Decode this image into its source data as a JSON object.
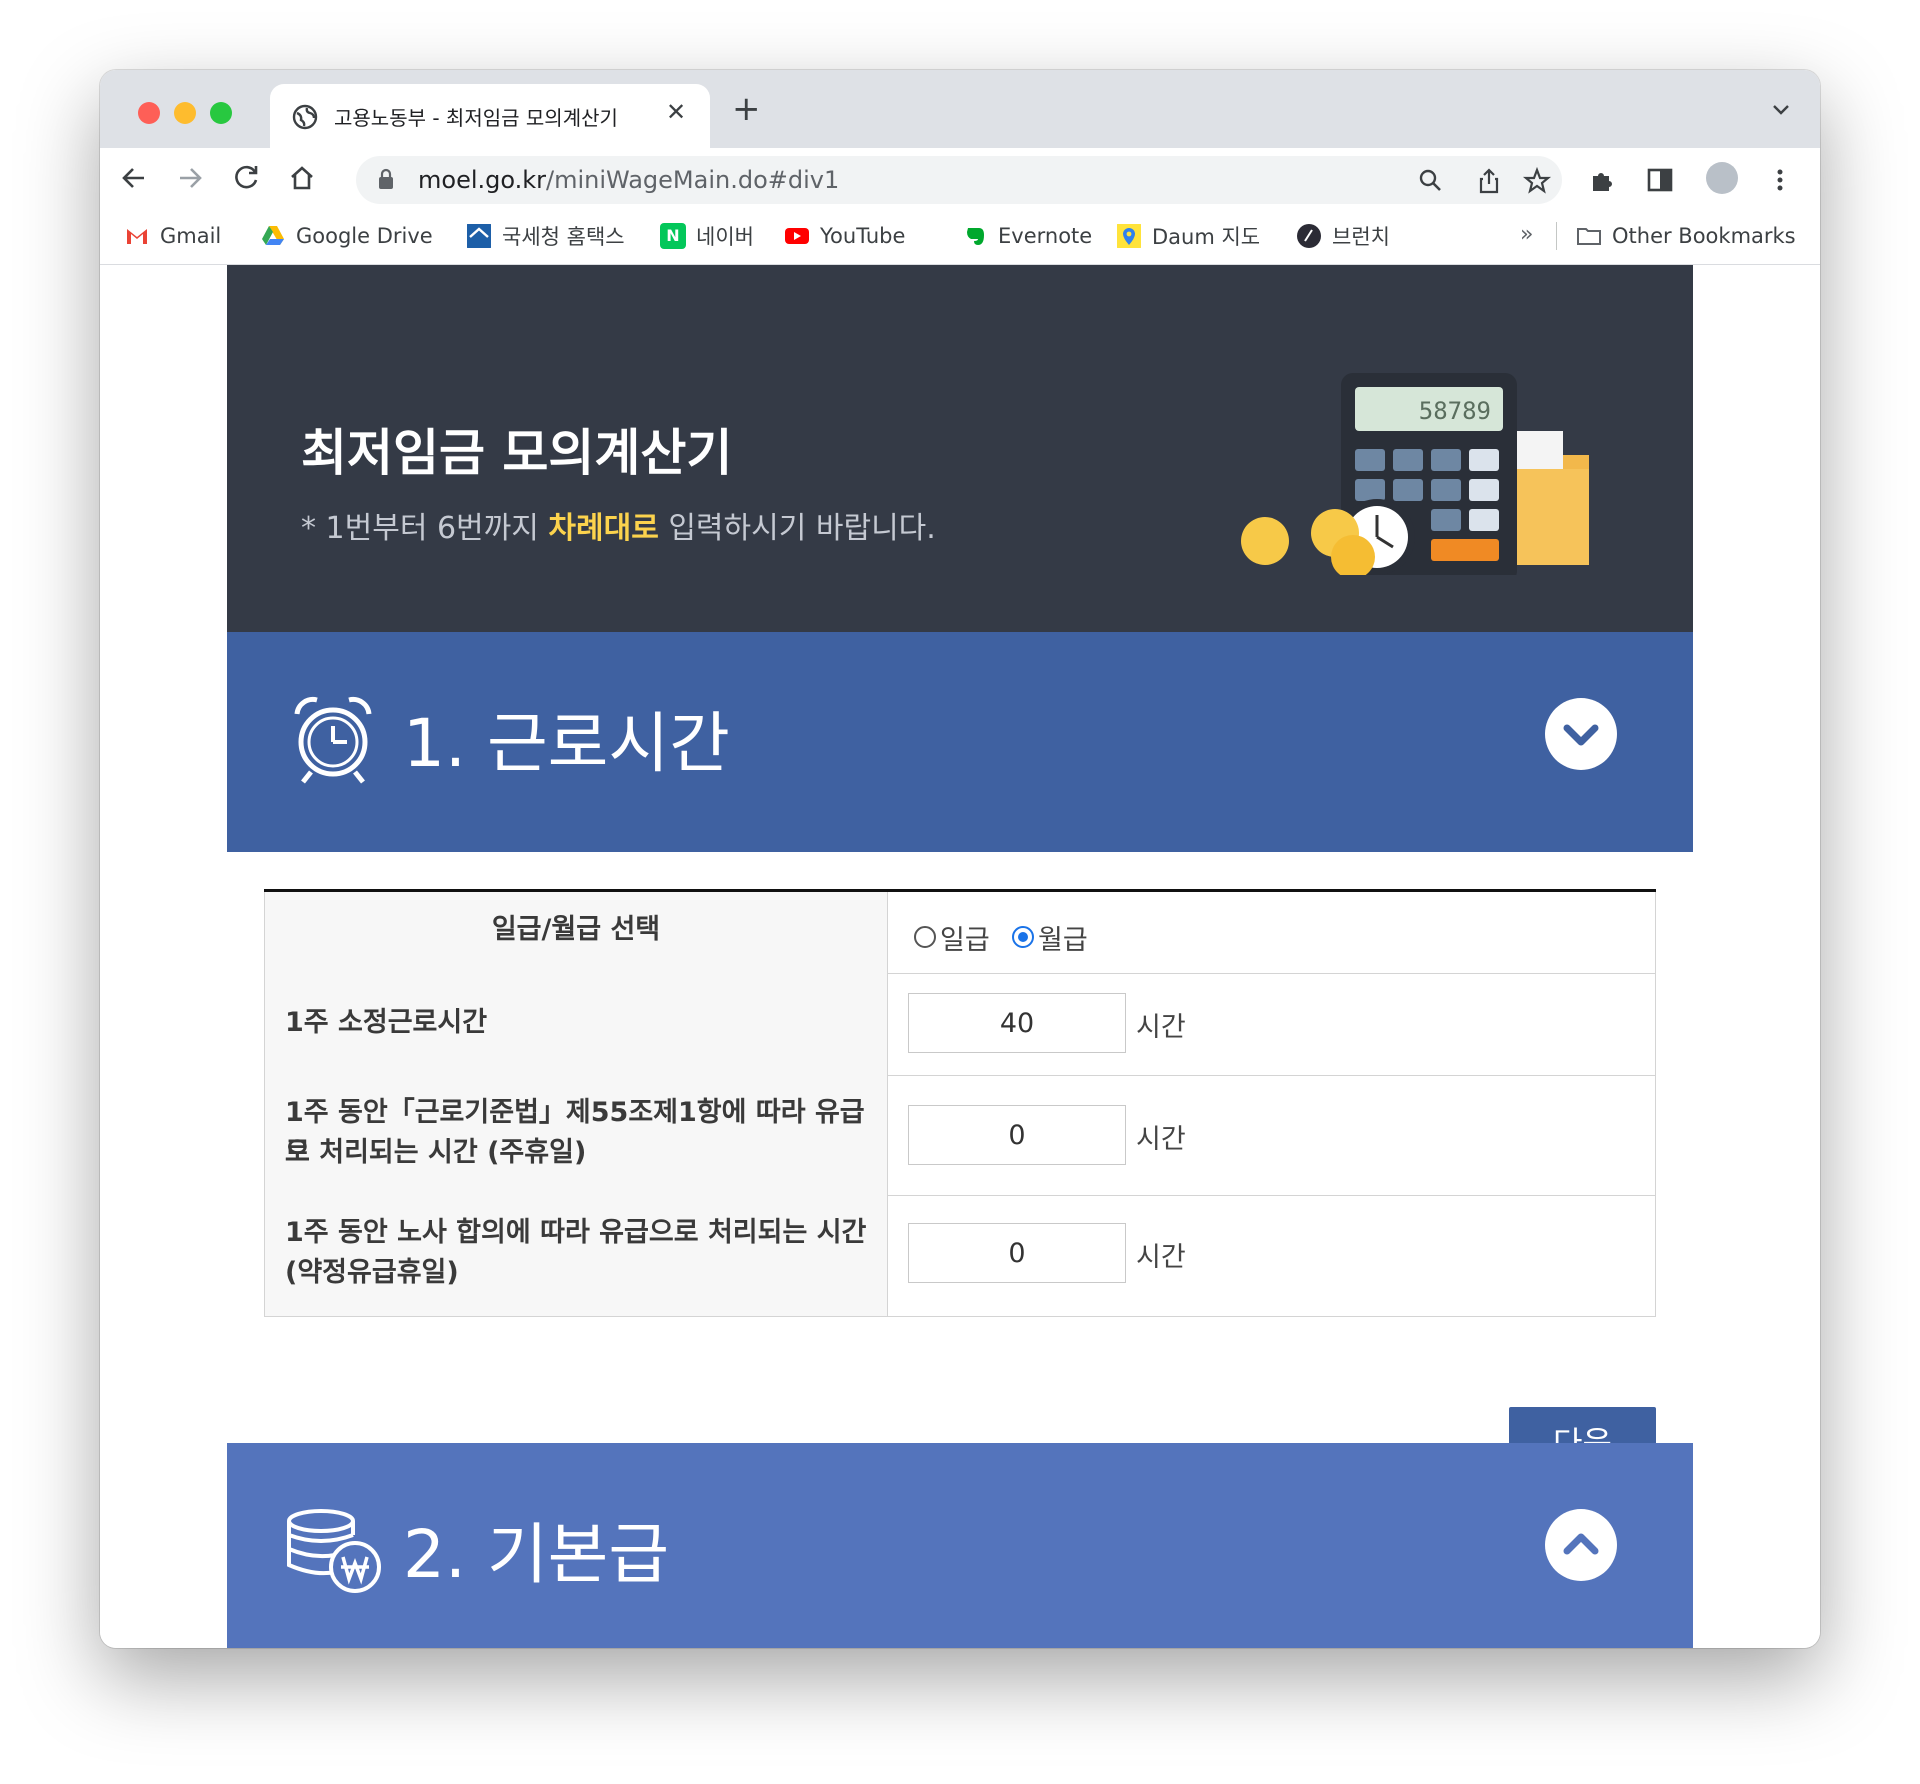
{
  "browser": {
    "tab_title": "고용노동부 - 최저임금 모의계산기",
    "tab_close": "✕",
    "new_tab": "+",
    "url_domain": "moel.go.kr",
    "url_path": "/miniWageMain.do#div1",
    "bookmarks": [
      {
        "label": "Gmail",
        "icon": "gmail-icon"
      },
      {
        "label": "Google Drive",
        "icon": "google-drive-icon"
      },
      {
        "label": "국세청 홈택스",
        "icon": "hometax-icon"
      },
      {
        "label": "네이버",
        "icon": "naver-icon"
      },
      {
        "label": "YouTube",
        "icon": "youtube-icon"
      },
      {
        "label": "Evernote",
        "icon": "evernote-icon"
      },
      {
        "label": "Daum 지도",
        "icon": "daum-map-icon"
      },
      {
        "label": "브런치",
        "icon": "brunch-icon"
      }
    ],
    "bookmarks_overflow": "»",
    "other_bookmarks": "Other Bookmarks"
  },
  "hero": {
    "title": "최저임금 모의계산기",
    "subtitle_before": "* 1번부터 6번까지 ",
    "subtitle_highlight": "차례대로",
    "subtitle_after": " 입력하시기 바랍니다.",
    "calculator_display": "58789"
  },
  "sections": [
    {
      "title": "1. 근로시간",
      "state": "expanded"
    },
    {
      "title": "2. 기본급",
      "state": "collapsed"
    }
  ],
  "form": {
    "pay_type_label": "일급/월급 선택",
    "pay_type_options": [
      "일급",
      "월급"
    ],
    "pay_type_selected": "월급",
    "rows": [
      {
        "label": "1주 소정근로시간",
        "value": "40",
        "unit": "시간"
      },
      {
        "label_line1": "1주 동안「근로기준법」제55조제1항에 따라 유급으",
        "label_line2": "로 처리되는 시간 (주휴일)",
        "value": "0",
        "unit": "시간"
      },
      {
        "label_line1": "1주 동안 노사 합의에 따라 유급으로 처리되는 시간",
        "label_line2": "(약정유급휴일)",
        "value": "0",
        "unit": "시간"
      }
    ],
    "next_button": "다음"
  },
  "colors": {
    "hero_bg": "#343a46",
    "section_active": "#3f61a1",
    "section_inactive": "#5474bc",
    "highlight": "#fcd34d"
  }
}
